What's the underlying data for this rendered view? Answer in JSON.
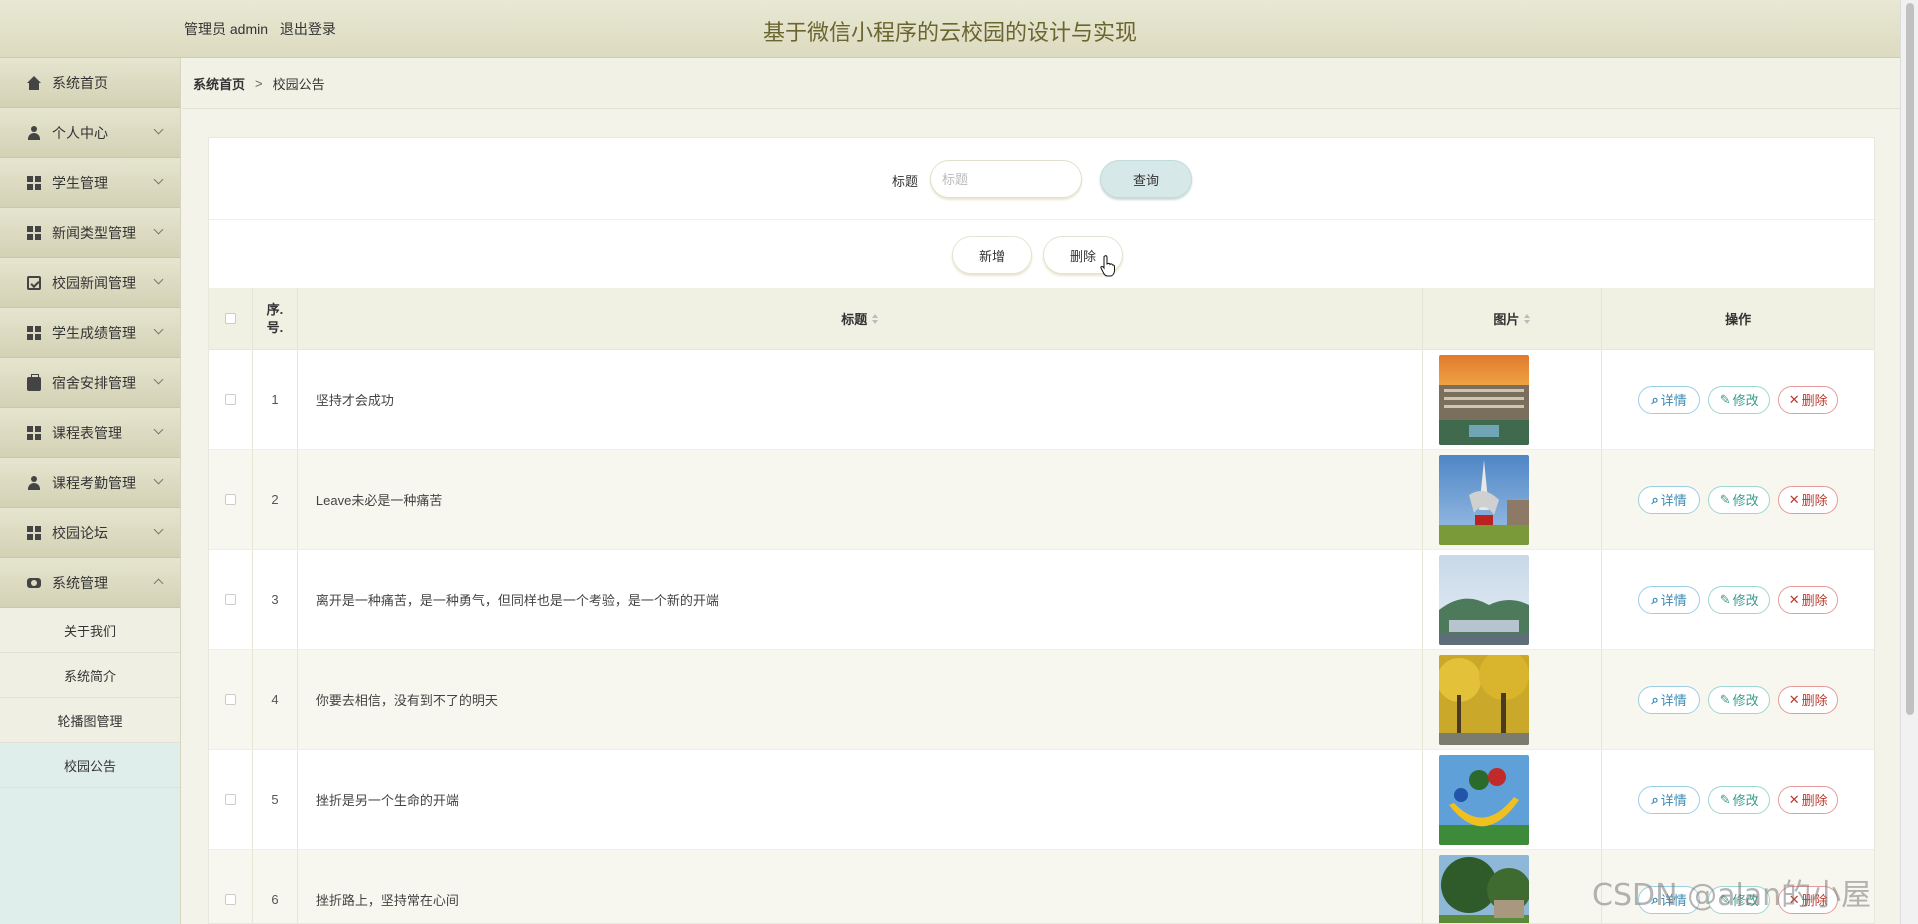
{
  "header": {
    "user_role_label": "管理员 admin",
    "logout_label": "退出登录",
    "app_title": "基于微信小程序的云校园的设计与实现"
  },
  "sidebar": {
    "items": [
      {
        "label": "系统首页",
        "icon": "home-icon"
      },
      {
        "label": "个人中心",
        "icon": "user-icon"
      },
      {
        "label": "学生管理",
        "icon": "grid-icon"
      },
      {
        "label": "新闻类型管理",
        "icon": "grid-icon"
      },
      {
        "label": "校园新闻管理",
        "icon": "clipboard-icon"
      },
      {
        "label": "学生成绩管理",
        "icon": "grid-icon"
      },
      {
        "label": "宿舍安排管理",
        "icon": "briefcase-icon"
      },
      {
        "label": "课程表管理",
        "icon": "grid-icon"
      },
      {
        "label": "课程考勤管理",
        "icon": "user-icon"
      },
      {
        "label": "校园论坛",
        "icon": "grid-icon"
      },
      {
        "label": "系统管理",
        "icon": "gear-icon"
      }
    ],
    "subitems": [
      {
        "label": "关于我们"
      },
      {
        "label": "系统简介"
      },
      {
        "label": "轮播图管理"
      },
      {
        "label": "校园公告"
      }
    ]
  },
  "breadcrumb": {
    "home": "系统首页",
    "separator": ">",
    "current": "校园公告"
  },
  "search": {
    "label": "标题",
    "placeholder": "标题",
    "button": "查询"
  },
  "actions": {
    "add": "新增",
    "delete": "删除"
  },
  "table": {
    "headers": {
      "no": "序.\n号.",
      "title": "标题",
      "image": "图片",
      "ops": "操作"
    },
    "op_labels": {
      "detail": "详情",
      "edit": "修改",
      "delete": "删除"
    },
    "rows": [
      {
        "no": "1",
        "title": "坚持才会成功"
      },
      {
        "no": "2",
        "title": "Leave未必是一种痛苦"
      },
      {
        "no": "3",
        "title": "离开是一种痛苦，是一种勇气，但同样也是一个考验，是一个新的开端"
      },
      {
        "no": "4",
        "title": "你要去相信，没有到不了的明天"
      },
      {
        "no": "5",
        "title": "挫折是另一个生命的开端"
      },
      {
        "no": "6",
        "title": "挫折路上，坚持常在心间"
      }
    ]
  },
  "watermark": "CSDN @alan的小屋"
}
